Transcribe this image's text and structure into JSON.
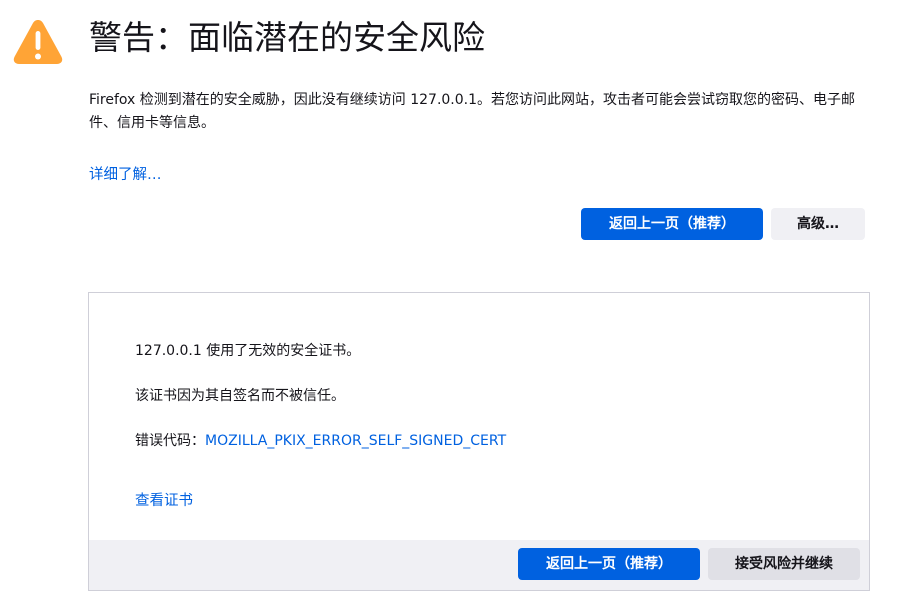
{
  "header": {
    "icon": "warning-triangle-icon",
    "icon_color": "#ffa436",
    "title": "警告：面临潜在的安全风险"
  },
  "main": {
    "description": "Firefox 检测到潜在的安全威胁，因此没有继续访问 127.0.0.1。若您访问此网站，攻击者可能会尝试窃取您的密码、电子邮件、信用卡等信息。",
    "learn_more": "详细了解…",
    "go_back_label": "返回上一页（推荐）",
    "advanced_label": "高级…"
  },
  "advanced_panel": {
    "cert_invalid": "127.0.0.1 使用了无效的安全证书。",
    "self_signed": "该证书因为其自签名而不被信任。",
    "error_code_prefix": "错误代码：",
    "error_code": "MOZILLA_PKIX_ERROR_SELF_SIGNED_CERT",
    "view_certificate": "查看证书",
    "go_back_label": "返回上一页（推荐）",
    "accept_label": "接受风险并继续"
  },
  "colors": {
    "accent": "#0061e0",
    "text": "#15141a",
    "secondary_button": "#f0f0f4",
    "panel_border": "#cfcfd8"
  }
}
